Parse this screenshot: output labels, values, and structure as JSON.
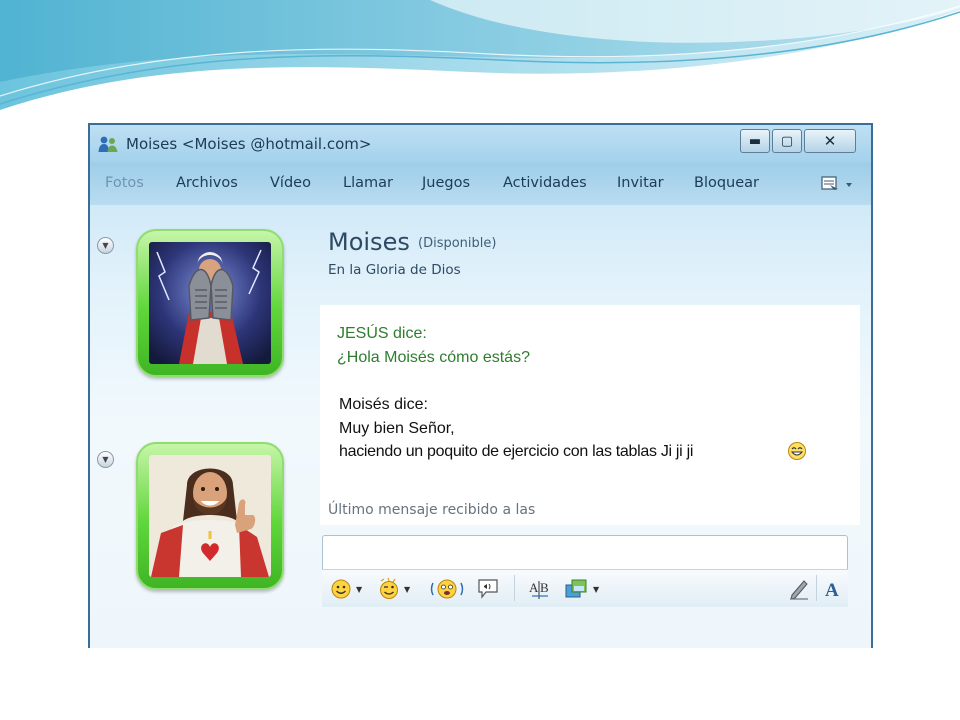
{
  "window": {
    "title": "Moises <Moises @hotmail.com>",
    "minimize_label": "▬",
    "maximize_label": "▢",
    "close_label": "✕"
  },
  "menu": {
    "items": [
      {
        "label": "Fotos"
      },
      {
        "label": "Archivos"
      },
      {
        "label": "Vídeo"
      },
      {
        "label": "Llamar"
      },
      {
        "label": "Juegos"
      },
      {
        "label": "Actividades"
      },
      {
        "label": "Invitar"
      },
      {
        "label": "Bloquear"
      }
    ]
  },
  "contact": {
    "name": "Moises",
    "status": "(Disponible)",
    "personal_message": "En la Gloria de Dios"
  },
  "conversation": {
    "messages": [
      {
        "sender": "JESÚS dice:",
        "lines": [
          "¿Hola Moisés cómo estás?"
        ]
      },
      {
        "sender": "Moisés dice:",
        "lines": [
          "Muy bien Señor,",
          "haciendo un poquito de ejercicio con las tablas Ji ji ji"
        ]
      }
    ]
  },
  "footer": {
    "last_message": "Último mensaje recibido a las"
  },
  "icons": {
    "app": "msn-buddies-icon",
    "menu_extra": "menu-options-icon",
    "emoticon": "smiley-icon",
    "wink": "wink-icon",
    "nudge": "nudge-icon",
    "voice_clip": "voice-clip-icon",
    "font": "font-icon",
    "background": "background-icon",
    "handwriting": "pencil-icon",
    "text_format": "text-format-icon",
    "grin": "grin-emoticon-icon"
  },
  "colors": {
    "sender_jesus": "#2e7d2e",
    "text_dark": "#111111",
    "frame_green": "#5fd63a"
  }
}
